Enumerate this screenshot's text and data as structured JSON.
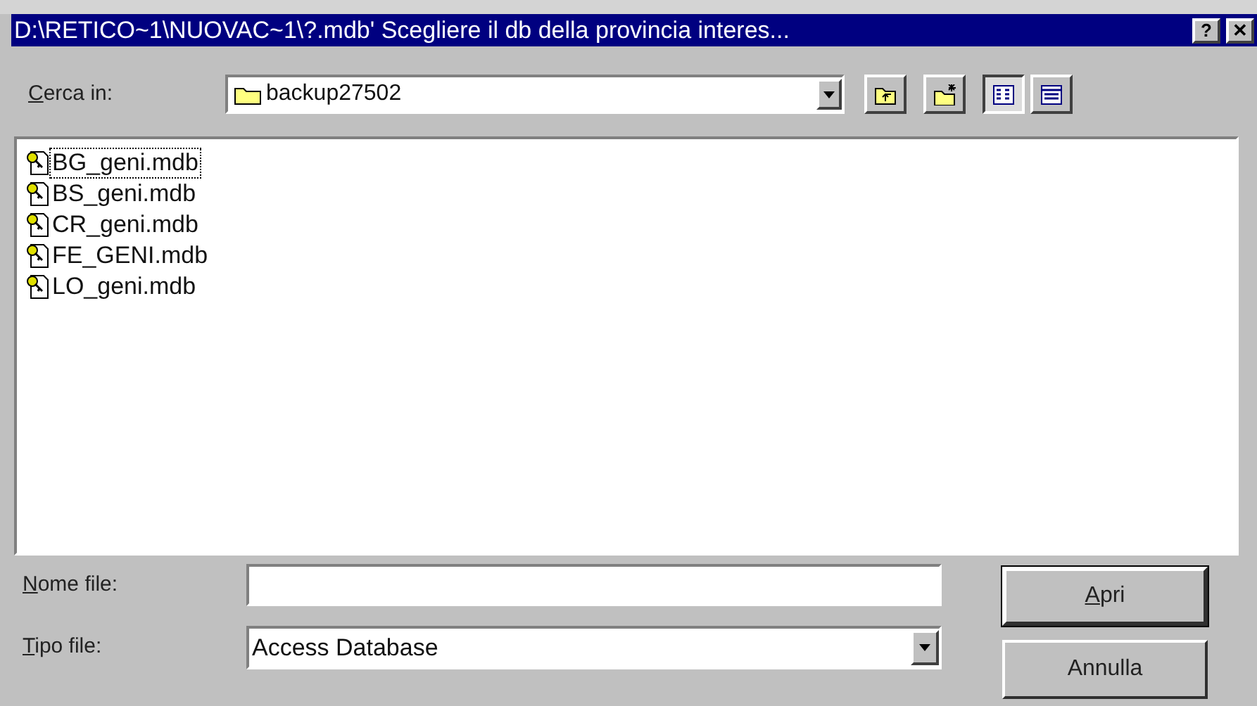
{
  "window": {
    "title": "D:\\RETICO~1\\NUOVAC~1\\?.mdb' Scegliere il db della provincia interes...",
    "title_buttons": [
      {
        "kind": "help",
        "label": "?"
      },
      {
        "kind": "close",
        "label": "✕"
      }
    ]
  },
  "look_in": {
    "label": {
      "key": "C",
      "rest": "erca in:"
    },
    "value": "backup27502"
  },
  "toolbar": [
    {
      "kind": "up"
    },
    {
      "kind": "new_folder"
    },
    {
      "kind": "list",
      "selected": true
    },
    {
      "kind": "details",
      "selected": false
    }
  ],
  "files": [
    {
      "name": "BG_geni.mdb",
      "focused": true
    },
    {
      "name": "BS_geni.mdb",
      "focused": false
    },
    {
      "name": "CR_geni.mdb",
      "focused": false
    },
    {
      "name": "FE_GENI.mdb",
      "focused": false
    },
    {
      "name": "LO_geni.mdb",
      "focused": false
    }
  ],
  "file_name": {
    "label": {
      "key": "N",
      "rest": "ome file:"
    }
  },
  "file_type": {
    "label": {
      "key": "T",
      "rest": "ipo file:"
    },
    "value": "Access Database"
  },
  "buttons": [
    {
      "label": {
        "key": "A",
        "rest": "pri"
      },
      "default": true
    },
    {
      "label": {
        "rest": "Annulla"
      },
      "default": false
    }
  ]
}
